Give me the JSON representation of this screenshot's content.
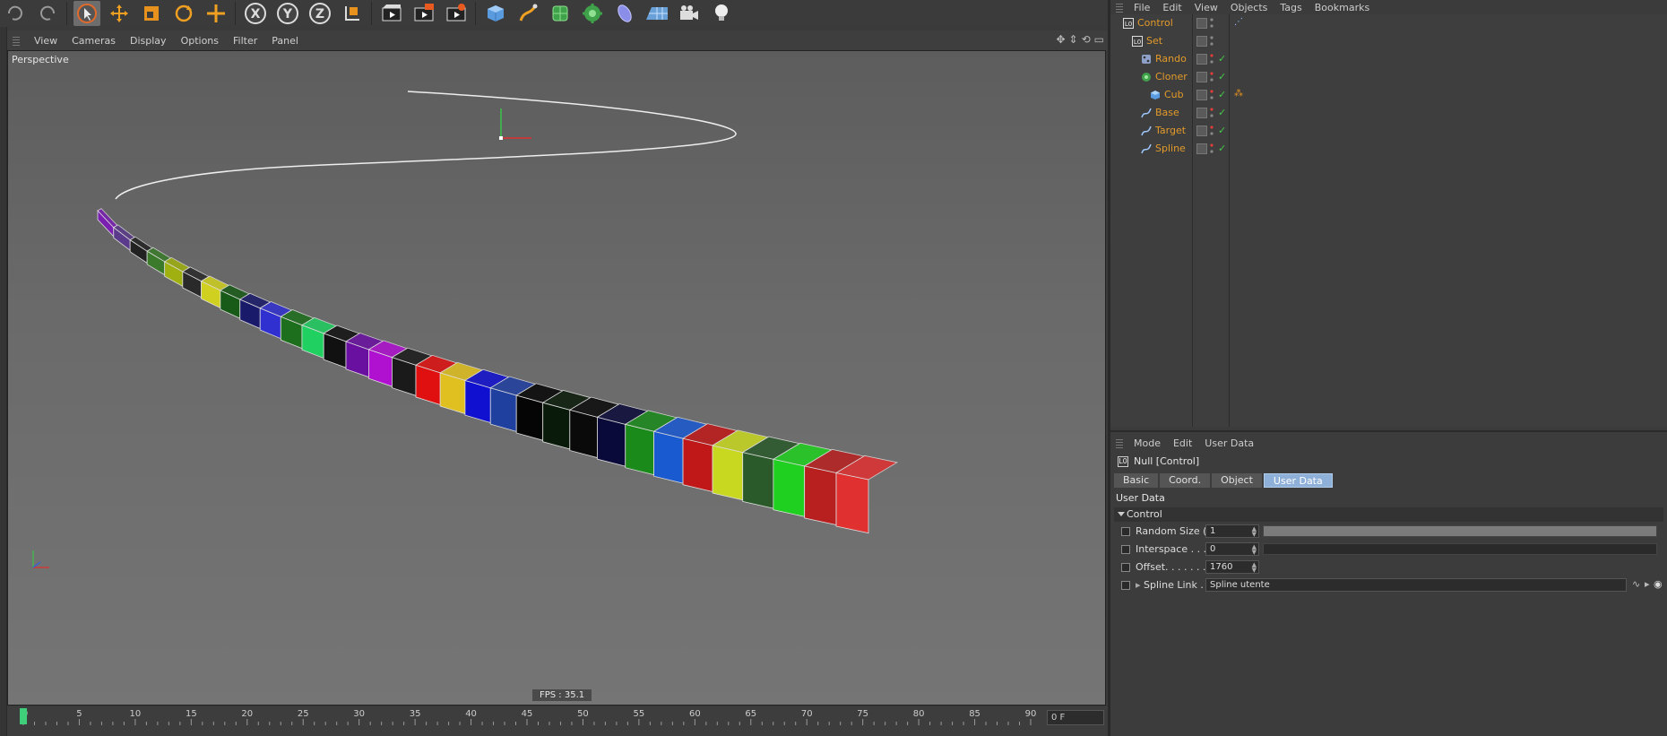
{
  "toolbar": {
    "icons": [
      "undo-icon",
      "redo-icon",
      "select-icon",
      "move-icon",
      "scale-icon",
      "rotate-icon",
      "live-select-icon",
      "x-axis-icon",
      "y-axis-icon",
      "z-axis-icon",
      "coordinate-system-icon",
      "render-view-icon",
      "render-picture-viewer-icon",
      "render-settings-icon",
      "cube-icon",
      "pen-icon",
      "subdivision-icon",
      "cloner-icon",
      "deformer-icon",
      "floor-icon",
      "camera-icon",
      "light-icon"
    ],
    "axis_x": "X",
    "axis_y": "Y",
    "axis_z": "Z"
  },
  "viewport": {
    "menu": [
      "View",
      "Cameras",
      "Display",
      "Options",
      "Filter",
      "Panel"
    ],
    "label": "Perspective",
    "fps": "FPS : 35.1"
  },
  "timeline": {
    "ticks": [
      "0",
      "5",
      "10",
      "15",
      "20",
      "25",
      "30",
      "35",
      "40",
      "45",
      "50",
      "55",
      "60",
      "65",
      "70",
      "75",
      "80",
      "85",
      "90"
    ],
    "current_frame": "0 F"
  },
  "object_manager": {
    "menu": [
      "File",
      "Edit",
      "View",
      "Objects",
      "Tags",
      "Bookmarks"
    ],
    "objects": [
      {
        "name": "Control",
        "icon": "null-icon",
        "depth": 0,
        "check": ""
      },
      {
        "name": "Set",
        "icon": "null-icon",
        "depth": 1,
        "check": ""
      },
      {
        "name": "Rando",
        "icon": "random-effector-icon",
        "depth": 2,
        "check": "✓"
      },
      {
        "name": "Cloner",
        "icon": "cloner-icon",
        "depth": 2,
        "check": "✓"
      },
      {
        "name": "Cub",
        "icon": "cube-icon",
        "depth": 3,
        "check": "✓"
      },
      {
        "name": "Base",
        "icon": "spline-icon",
        "depth": 2,
        "check": "✓"
      },
      {
        "name": "Target",
        "icon": "spline-icon",
        "depth": 2,
        "check": "✓"
      },
      {
        "name": "Spline",
        "icon": "spline-icon",
        "depth": 2,
        "check": "✓"
      }
    ]
  },
  "attributes": {
    "menu": [
      "Mode",
      "Edit",
      "User Data"
    ],
    "title": "Null [Control]",
    "tabs": [
      "Basic",
      "Coord.",
      "Object",
      "User Data"
    ],
    "active_tab": "User Data",
    "section": "User Data",
    "group": "Control",
    "params": [
      {
        "label": "Random Size (Z)",
        "value": "1",
        "slider": 1.0
      },
      {
        "label": "Interspace . . . .",
        "value": "0",
        "slider": 0.0
      },
      {
        "label": "Offset. . . . . . . .",
        "value": "1760"
      },
      {
        "label": "Spline Link . . .",
        "link": "Spline  utente"
      }
    ]
  }
}
